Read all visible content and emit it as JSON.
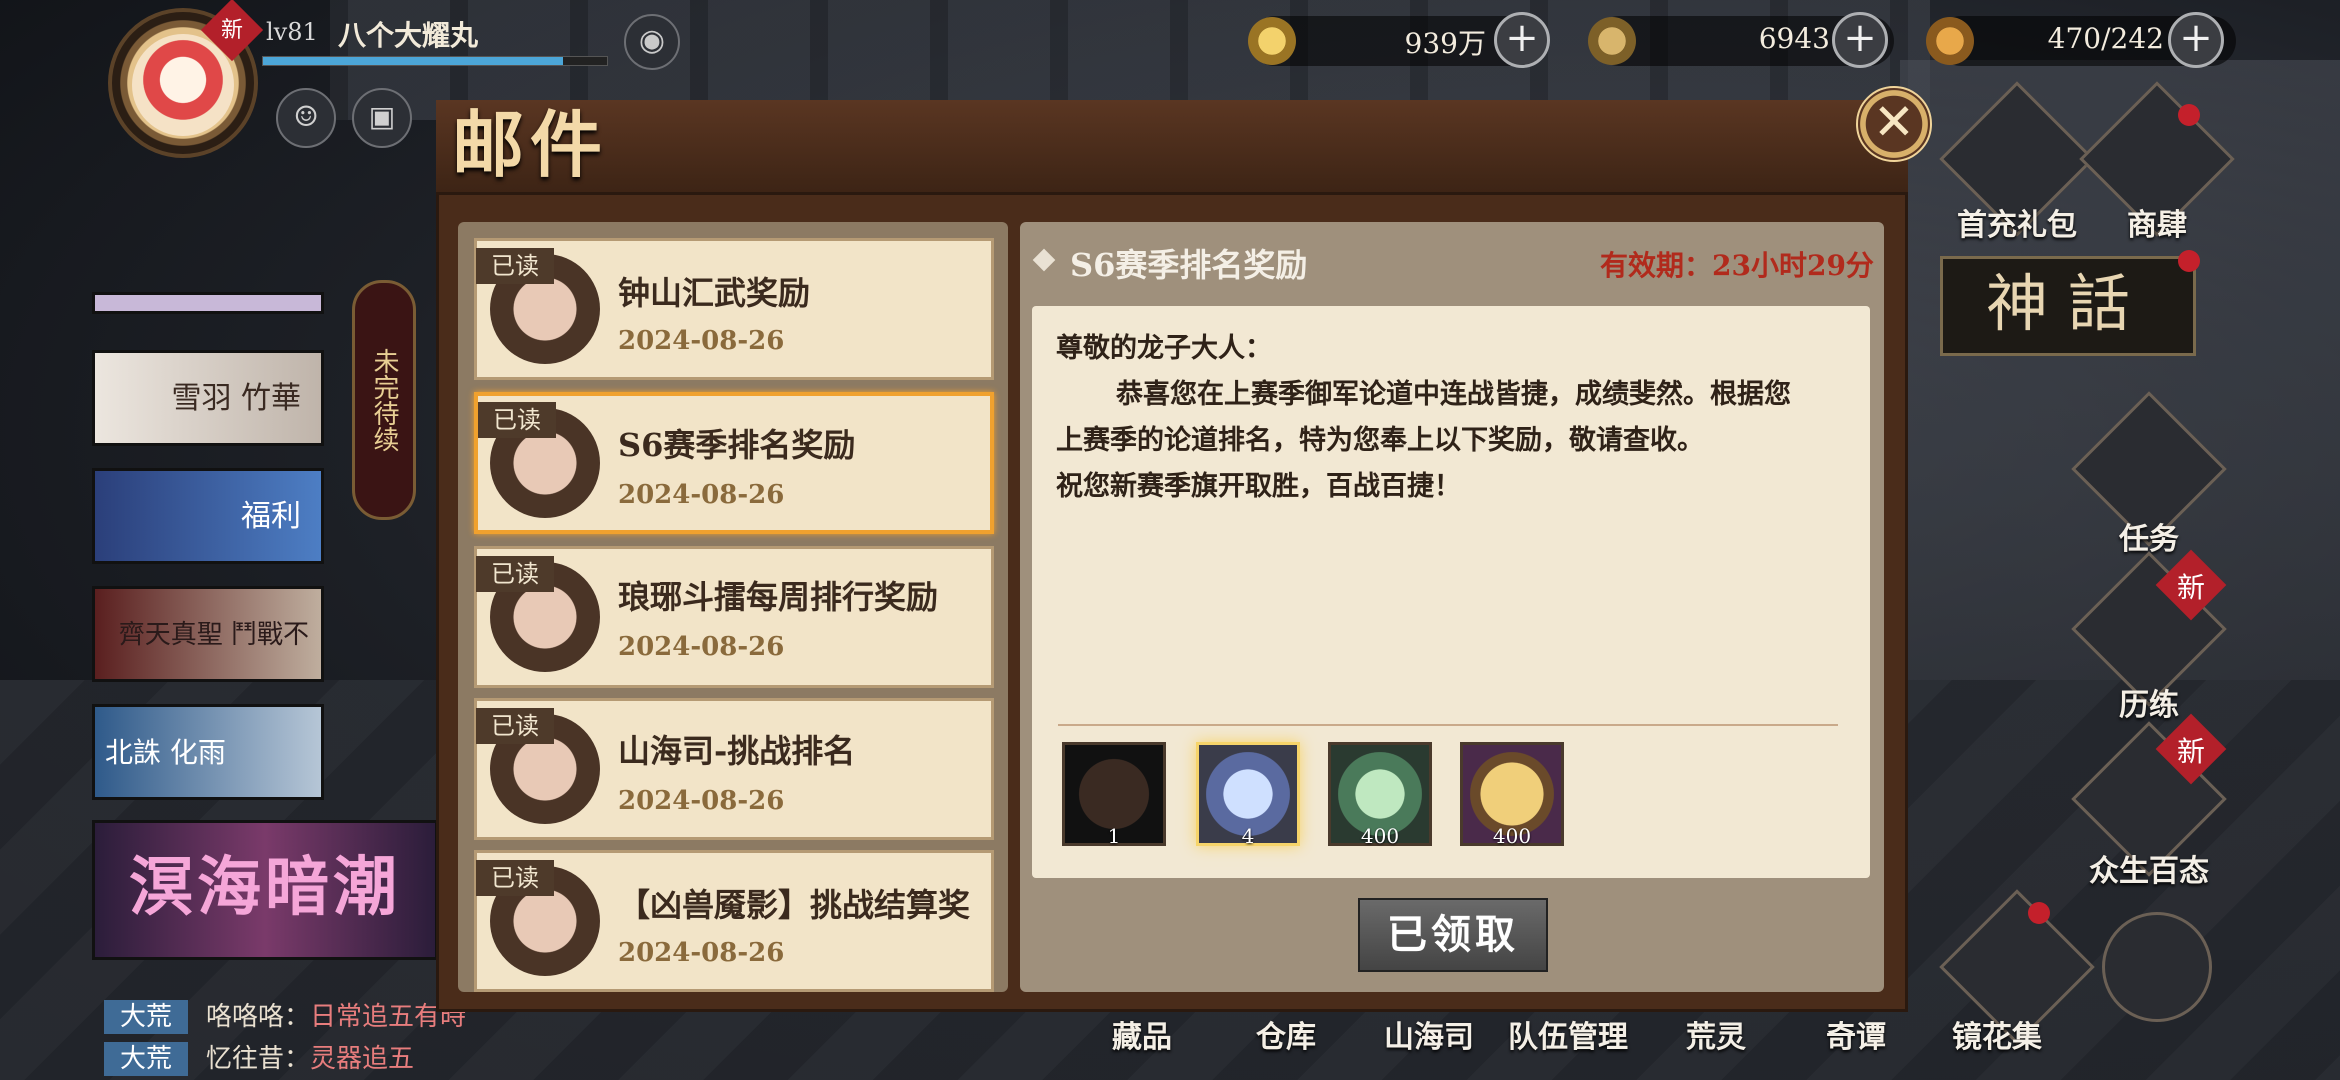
{
  "player": {
    "new_badge": "新",
    "level": "lv81",
    "name": "八个大耀丸"
  },
  "currency": [
    {
      "icon": "coin-icon",
      "value": "939万"
    },
    {
      "icon": "gear-token-icon",
      "value": "6943"
    },
    {
      "icon": "gourd-icon",
      "value": "470/242"
    }
  ],
  "left": {
    "side_vertical": "未完待续",
    "card_texts": [
      "雪羽 竹華",
      "福利",
      "齊天真聖 鬥戰不息",
      "北誅 化雨"
    ],
    "banner": "溟海暗潮",
    "chat": [
      {
        "tag": "大荒",
        "name": "咯咯咯：",
        "msg": "日常追五有時"
      },
      {
        "tag": "大荒",
        "name": "忆往昔：",
        "msg": "灵器追五"
      }
    ]
  },
  "right_menu": [
    {
      "label": "首充礼包"
    },
    {
      "label": "商肆"
    },
    {
      "label": "任务"
    },
    {
      "label": "历练",
      "badge": "新"
    },
    {
      "label": "众生百态",
      "badge": "新"
    }
  ],
  "myth_label": "神話",
  "bottom_menu": [
    "藏品",
    "仓库",
    "山海司",
    "队伍管理",
    "荒灵",
    "奇谭",
    "镜花集"
  ],
  "dialog": {
    "title": "邮件",
    "close": "✕",
    "mails": [
      {
        "tag": "已读",
        "title": "钟山汇武奖励",
        "date": "2024-08-26"
      },
      {
        "tag": "已读",
        "title": "S6赛季排名奖励",
        "date": "2024-08-26"
      },
      {
        "tag": "已读",
        "title": "琅琊斗擂每周排行奖励",
        "date": "2024-08-26"
      },
      {
        "tag": "已读",
        "title": "山海司-挑战排名",
        "date": "2024-08-26"
      },
      {
        "tag": "已读",
        "title": "【凶兽魇影】挑战结算奖",
        "date": "2024-08-26"
      }
    ],
    "detail": {
      "title": "S6赛季排名奖励",
      "expiry": "有效期：23小时29分",
      "greeting": "尊敬的龙子大人：",
      "line1": "恭喜您在上赛季御军论道中连战皆捷，成绩斐然。根据您",
      "line2": "上赛季的论道排名，特为您奉上以下奖励，敬请查收。",
      "line3": "祝您新赛季旗开取胜，百战百捷！",
      "rewards": [
        {
          "icon": "s6-badge-icon",
          "count": "1"
        },
        {
          "icon": "crystal-icon",
          "count": "4"
        },
        {
          "icon": "lotus-icon",
          "count": "400"
        },
        {
          "icon": "gold-emblem-icon",
          "count": "400"
        }
      ],
      "claimed_button": "已领取"
    }
  }
}
